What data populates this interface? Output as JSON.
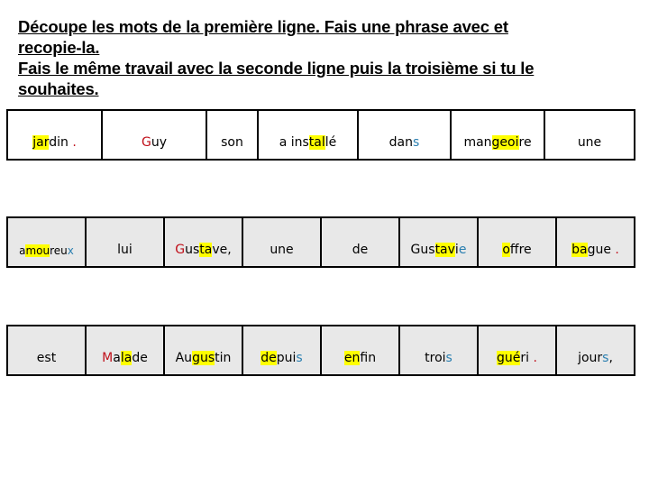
{
  "instructions": {
    "line1": "Découpe les mots de la première ligne. Fais une phrase avec et",
    "line2": "recopie-la.",
    "line3": "Fais le même travail avec la seconde ligne puis la troisième si tu le",
    "line4": "souhaites."
  },
  "colors": {
    "highlight": "#ffff00",
    "red": "#c0101a",
    "blue": "#2a7fb0",
    "row_gray": "#e8e8e8"
  },
  "rows": [
    {
      "words": [
        {
          "text": "jardin .",
          "parts": [
            {
              "t": "jar",
              "s": "hl"
            },
            {
              "t": "din ",
              "s": ""
            },
            {
              "t": ".",
              "s": "red"
            }
          ]
        },
        {
          "text": "Guy",
          "parts": [
            {
              "t": "G",
              "s": "red"
            },
            {
              "t": "uy",
              "s": ""
            }
          ]
        },
        {
          "text": "son",
          "parts": [
            {
              "t": "son",
              "s": ""
            }
          ]
        },
        {
          "text": "a installé",
          "parts": [
            {
              "t": "a ins",
              "s": ""
            },
            {
              "t": "tal",
              "s": "hl"
            },
            {
              "t": "lé",
              "s": ""
            }
          ]
        },
        {
          "text": "dans",
          "parts": [
            {
              "t": "dan",
              "s": ""
            },
            {
              "t": "s",
              "s": "blue"
            }
          ]
        },
        {
          "text": "mangeoire",
          "parts": [
            {
              "t": "man",
              "s": ""
            },
            {
              "t": "geoi",
              "s": "hl"
            },
            {
              "t": "re",
              "s": ""
            }
          ]
        },
        {
          "text": "une",
          "parts": [
            {
              "t": "une",
              "s": ""
            }
          ]
        }
      ]
    },
    {
      "words": [
        {
          "text": "amoureux",
          "parts": [
            {
              "t": "a",
              "s": ""
            },
            {
              "t": "mou",
              "s": "hl"
            },
            {
              "t": "reu",
              "s": ""
            },
            {
              "t": "x",
              "s": "blue"
            }
          ]
        },
        {
          "text": "lui",
          "parts": [
            {
              "t": "lui",
              "s": ""
            }
          ]
        },
        {
          "text": "Gustave,",
          "parts": [
            {
              "t": "G",
              "s": "red"
            },
            {
              "t": "us",
              "s": ""
            },
            {
              "t": "ta",
              "s": "hl"
            },
            {
              "t": "ve,",
              "s": ""
            }
          ]
        },
        {
          "text": "une",
          "parts": [
            {
              "t": "une",
              "s": ""
            }
          ]
        },
        {
          "text": "de",
          "parts": [
            {
              "t": "de",
              "s": ""
            }
          ]
        },
        {
          "text": "Gustavie",
          "parts": [
            {
              "t": "Gus",
              "s": ""
            },
            {
              "t": "tav",
              "s": "hl"
            },
            {
              "t": "i",
              "s": ""
            },
            {
              "t": "e",
              "s": "blue"
            }
          ]
        },
        {
          "text": "offre",
          "parts": [
            {
              "t": "o",
              "s": "hl"
            },
            {
              "t": "ffre",
              "s": ""
            }
          ]
        },
        {
          "text": "bague .",
          "parts": [
            {
              "t": "ba",
              "s": "hl"
            },
            {
              "t": "gue ",
              "s": ""
            },
            {
              "t": ".",
              "s": "red"
            }
          ]
        }
      ]
    },
    {
      "words": [
        {
          "text": "est",
          "parts": [
            {
              "t": "est",
              "s": ""
            }
          ]
        },
        {
          "text": "Malade",
          "parts": [
            {
              "t": "M",
              "s": "red"
            },
            {
              "t": "a",
              "s": ""
            },
            {
              "t": "la",
              "s": "hl"
            },
            {
              "t": "de",
              "s": ""
            }
          ]
        },
        {
          "text": "Augustin",
          "parts": [
            {
              "t": "Au",
              "s": ""
            },
            {
              "t": "gus",
              "s": "hl"
            },
            {
              "t": "tin",
              "s": ""
            }
          ]
        },
        {
          "text": "depuis",
          "parts": [
            {
              "t": "de",
              "s": "hl"
            },
            {
              "t": "pui",
              "s": ""
            },
            {
              "t": "s",
              "s": "blue"
            }
          ]
        },
        {
          "text": "enfin",
          "parts": [
            {
              "t": "en",
              "s": "hl"
            },
            {
              "t": "fin",
              "s": ""
            }
          ]
        },
        {
          "text": "trois",
          "parts": [
            {
              "t": "troi",
              "s": ""
            },
            {
              "t": "s",
              "s": "blue"
            }
          ]
        },
        {
          "text": "guéri .",
          "parts": [
            {
              "t": "gué",
              "s": "hl"
            },
            {
              "t": "ri ",
              "s": ""
            },
            {
              "t": ".",
              "s": "red"
            }
          ]
        },
        {
          "text": "jours,",
          "parts": [
            {
              "t": "jour",
              "s": ""
            },
            {
              "t": "s",
              "s": "blue"
            },
            {
              "t": ",",
              "s": ""
            }
          ]
        }
      ]
    }
  ]
}
